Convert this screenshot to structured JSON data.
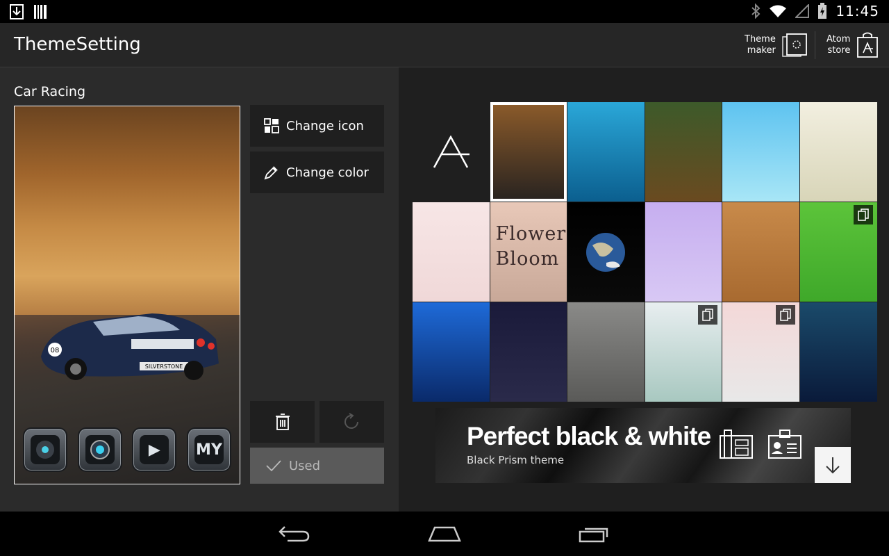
{
  "status_bar": {
    "time": "11:45",
    "icons": [
      "download-icon",
      "barcode-icon",
      "bluetooth-icon",
      "wifi-icon",
      "signal-icon",
      "battery-charging-icon"
    ]
  },
  "action_bar": {
    "title": "ThemeSetting",
    "theme_maker": {
      "line1": "Theme",
      "line2": "maker",
      "icon": "theme-maker-icon"
    },
    "atom_store": {
      "line1": "Atom",
      "line2": "store",
      "icon": "store-bag-icon"
    }
  },
  "current_theme": {
    "name": "Car Racing",
    "plate": "SILVERSTONE",
    "dock_icons": [
      {
        "name": "music-player-icon",
        "text": ""
      },
      {
        "name": "camera-icon",
        "text": ""
      },
      {
        "name": "video-play-icon",
        "text": "▶"
      },
      {
        "name": "my-files-icon",
        "text": "MY"
      }
    ]
  },
  "actions": {
    "change_icon": "Change icon",
    "change_color": "Change color",
    "used": "Used"
  },
  "theme_grid": {
    "tiles": [
      {
        "name": "atom-logo-tile",
        "colors": [
          "#1f1f1f",
          "#1f1f1f"
        ],
        "selected": false,
        "badge": false
      },
      {
        "name": "car-racing-tile",
        "colors": [
          "#8a5a2a",
          "#2a2420"
        ],
        "selected": true,
        "badge": false
      },
      {
        "name": "surfing-tile",
        "colors": [
          "#2aa7d8",
          "#0b5f8f"
        ],
        "selected": false,
        "badge": false
      },
      {
        "name": "campfire-forest-tile",
        "colors": [
          "#3d5a2a",
          "#6a4a20"
        ],
        "selected": false,
        "badge": false
      },
      {
        "name": "sailboat-clouds-tile",
        "colors": [
          "#5ec3f0",
          "#a8e6f6"
        ],
        "selected": false,
        "badge": false
      },
      {
        "name": "cartoon-boy-tile",
        "colors": [
          "#f2efe0",
          "#d8d5b8"
        ],
        "selected": false,
        "badge": false
      },
      {
        "name": "bicycle-couple-tile",
        "colors": [
          "#f7e6e6",
          "#f0d8d8"
        ],
        "selected": false,
        "badge": false
      },
      {
        "name": "flower-bloom-tile",
        "colors": [
          "#e8c8b8",
          "#c8a898"
        ],
        "selected": false,
        "badge": false
      },
      {
        "name": "earth-tile",
        "colors": [
          "#000000",
          "#0a0a0a"
        ],
        "selected": false,
        "badge": false
      },
      {
        "name": "houses-lilac-tile",
        "colors": [
          "#c6aef0",
          "#d8c8f4"
        ],
        "selected": false,
        "badge": false
      },
      {
        "name": "desk-items-tile",
        "colors": [
          "#c88a4a",
          "#a86a30"
        ],
        "selected": false,
        "badge": false
      },
      {
        "name": "lego-icons-tile",
        "colors": [
          "#5cc43a",
          "#3fa82a"
        ],
        "selected": false,
        "badge": true
      },
      {
        "name": "big-ben-tile",
        "colors": [
          "#1e6ad8",
          "#0a2a6a"
        ],
        "selected": false,
        "badge": false
      },
      {
        "name": "bunny-monster-tile",
        "colors": [
          "#1a1a3a",
          "#2a2a4a"
        ],
        "selected": false,
        "badge": false
      },
      {
        "name": "rainy-window-tile",
        "colors": [
          "#8a8a88",
          "#5a5a58"
        ],
        "selected": false,
        "badge": false
      },
      {
        "name": "eiffel-tower-tile",
        "colors": [
          "#e8eef0",
          "#a8c8c0"
        ],
        "selected": false,
        "badge": true
      },
      {
        "name": "white-garden-tile",
        "colors": [
          "#f4d8d8",
          "#e8e8e8"
        ],
        "selected": false,
        "badge": true
      },
      {
        "name": "aurora-tile",
        "colors": [
          "#1a4a6a",
          "#0a1a3a"
        ],
        "selected": false,
        "badge": false
      }
    ],
    "grid_tile_flower_text_1": "Flower",
    "grid_tile_flower_text_2": "Bloom"
  },
  "banner": {
    "headline": "Perfect black & white",
    "subtitle": "Black Prism theme"
  }
}
